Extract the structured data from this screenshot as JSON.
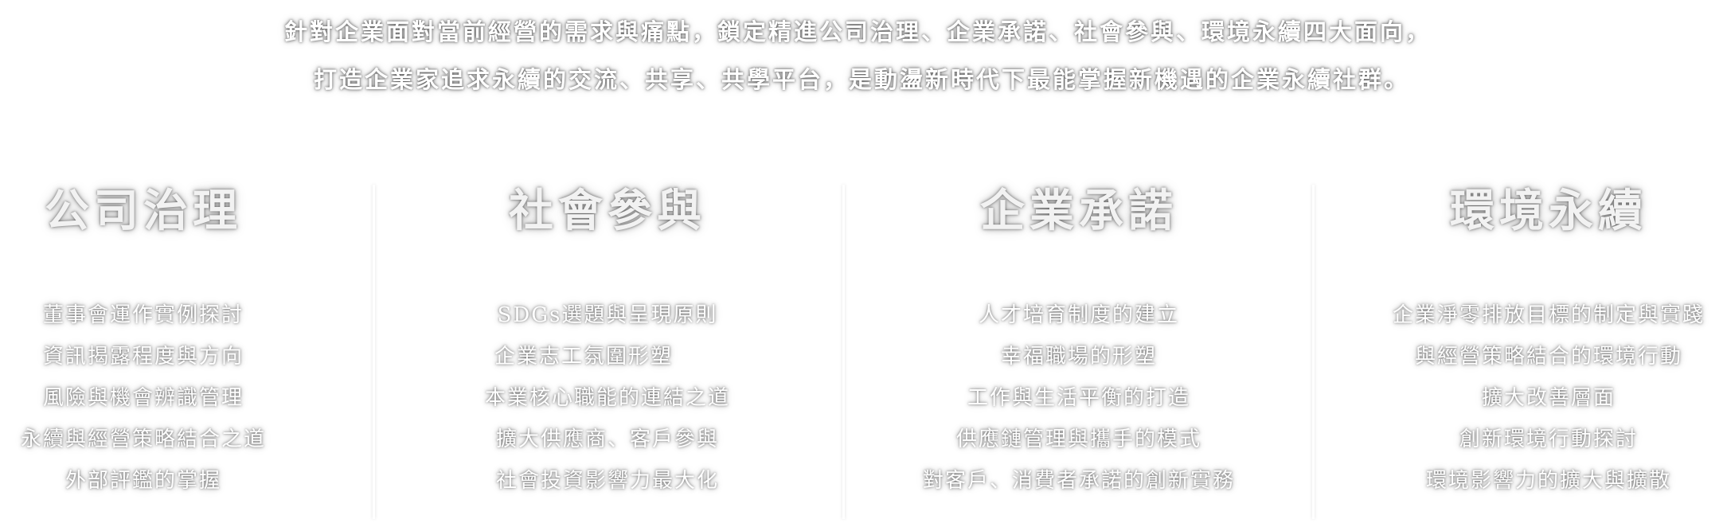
{
  "intro": {
    "line1": "針對企業面對當前經營的需求與痛點，鎖定精進公司治理、企業承諾、社會參與、環境永續四大面向，",
    "line2": "打造企業家追求永續的交流、共享、共學平台，是動盪新時代下最能掌握新機遇的企業永續社群。"
  },
  "pillars": [
    {
      "title": "公司治理",
      "items": [
        "董事會運作實例探討",
        "資訊揭露程度與方向",
        "風險與機會辨識管理",
        "永續與經營策略結合之道",
        "外部評鑑的掌握"
      ]
    },
    {
      "title": "社會參與",
      "items": [
        "SDGs選題與呈現原則",
        "企業志工氛圍形塑",
        "本業核心職能的連結之道",
        "擴大供應商、客戶參與",
        "社會投資影響力最大化"
      ]
    },
    {
      "title": "企業承諾",
      "items": [
        "人才培育制度的建立",
        "幸福職場的形塑",
        "工作與生活平衡的打造",
        "供應鏈管理與攜手的模式",
        "對客戶、消費者承諾的創新實務"
      ]
    },
    {
      "title": "環境永續",
      "items": [
        "企業淨零排放目標的制定與實踐",
        "與經營策略結合的環境行動",
        "擴大改善層面",
        "創新環境行動探討",
        "環境影響力的擴大與擴散"
      ]
    }
  ]
}
